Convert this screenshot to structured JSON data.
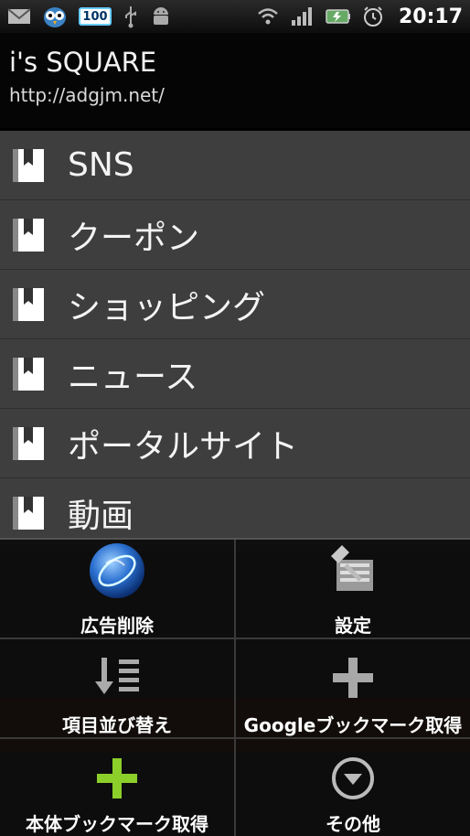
{
  "status_bar": {
    "battery_level": "100",
    "time": "20:17",
    "icons_left": [
      "mail-icon",
      "owl-icon",
      "battery-icon",
      "usb-icon",
      "android-icon"
    ],
    "icons_right": [
      "wifi-icon",
      "signal-icon",
      "battery-charge-icon",
      "alarm-icon"
    ]
  },
  "header": {
    "title": "i's SQUARE",
    "url": "http://adgjm.net/"
  },
  "list": {
    "items": [
      {
        "label": "SNS"
      },
      {
        "label": "クーポン"
      },
      {
        "label": "ショッピング"
      },
      {
        "label": "ニュース"
      },
      {
        "label": "ポータルサイト"
      },
      {
        "label": "動画"
      }
    ]
  },
  "menu": {
    "items": [
      {
        "label": "広告削除",
        "icon": "globe-icon"
      },
      {
        "label": "設定",
        "icon": "settings-icon"
      },
      {
        "label": "項目並び替え",
        "icon": "sort-icon"
      },
      {
        "label": "Googleブックマーク取得",
        "icon": "plus-gray-icon"
      },
      {
        "label": "本体ブックマーク取得",
        "icon": "plus-green-icon"
      },
      {
        "label": "その他",
        "icon": "more-icon"
      }
    ]
  },
  "colors": {
    "list_bg": "#3e3e3e",
    "menu_bg": "#080808",
    "accent_green": "#8ccf2a"
  }
}
